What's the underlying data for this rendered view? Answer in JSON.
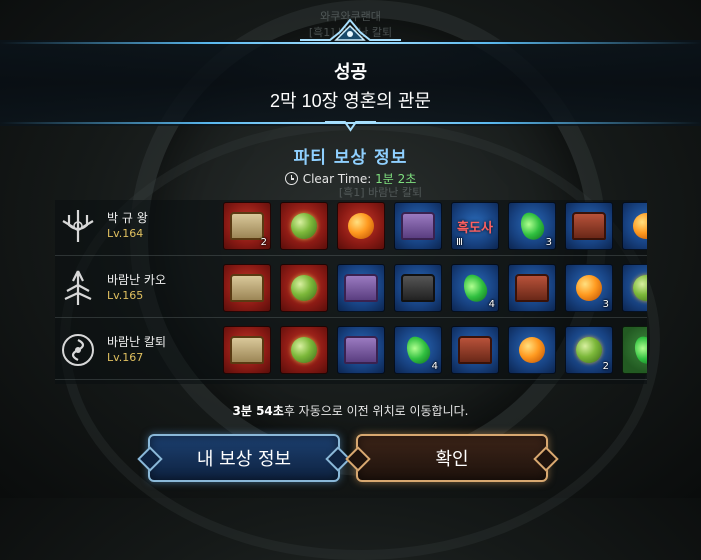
{
  "background": {
    "ghost_lines": [
      "와쿠와쿠랜대",
      "[흑1] 바람난 칼퇴",
      "[흑1] 바람난 칼퇴"
    ]
  },
  "header": {
    "result": "성공",
    "stage": "2막 10장 영혼의 관문"
  },
  "rewards": {
    "title": "파티 보상 정보",
    "clear_time_label": "Clear Time:",
    "clear_time_value": "1분 2초",
    "players": [
      {
        "name": "박 규 왕",
        "level": "Lv.164",
        "class_icon": "trident-crest-icon",
        "items": [
          {
            "bg": "red",
            "kind": "chest",
            "variant": "gold",
            "count": "2"
          },
          {
            "bg": "red",
            "kind": "orb",
            "variant": "green",
            "count": ""
          },
          {
            "bg": "red",
            "kind": "orb",
            "variant": "orange",
            "count": ""
          },
          {
            "bg": "blue",
            "kind": "chest",
            "variant": "purple",
            "count": ""
          },
          {
            "bg": "blue",
            "kind": "text",
            "variant": "흑도사",
            "count": "Ⅲ"
          },
          {
            "bg": "blue",
            "kind": "leaf",
            "variant": "green",
            "count": "3"
          },
          {
            "bg": "blue",
            "kind": "chest",
            "variant": "red",
            "count": ""
          },
          {
            "bg": "blue",
            "kind": "orb",
            "variant": "orange",
            "count": ""
          }
        ]
      },
      {
        "name": "바람난 카오",
        "level": "Lv.165",
        "class_icon": "spear-crest-icon",
        "items": [
          {
            "bg": "red",
            "kind": "chest",
            "variant": "gold",
            "count": ""
          },
          {
            "bg": "red",
            "kind": "orb",
            "variant": "green",
            "count": ""
          },
          {
            "bg": "blue",
            "kind": "chest",
            "variant": "purple",
            "count": ""
          },
          {
            "bg": "blue",
            "kind": "chest",
            "variant": "dark",
            "count": ""
          },
          {
            "bg": "blue",
            "kind": "leaf",
            "variant": "green",
            "count": "4"
          },
          {
            "bg": "blue",
            "kind": "chest",
            "variant": "red",
            "count": ""
          },
          {
            "bg": "blue",
            "kind": "orb",
            "variant": "orange",
            "count": "3"
          },
          {
            "bg": "blue",
            "kind": "orb",
            "variant": "green",
            "count": ""
          }
        ]
      },
      {
        "name": "바람난 칼퇴",
        "level": "Lv.167",
        "class_icon": "swirl-crest-icon",
        "items": [
          {
            "bg": "red",
            "kind": "chest",
            "variant": "gold",
            "count": ""
          },
          {
            "bg": "red",
            "kind": "orb",
            "variant": "green",
            "count": ""
          },
          {
            "bg": "blue",
            "kind": "chest",
            "variant": "purple",
            "count": ""
          },
          {
            "bg": "blue",
            "kind": "leaf",
            "variant": "green",
            "count": "4"
          },
          {
            "bg": "blue",
            "kind": "chest",
            "variant": "red",
            "count": ""
          },
          {
            "bg": "blue",
            "kind": "orb",
            "variant": "orange",
            "count": ""
          },
          {
            "bg": "blue",
            "kind": "orb",
            "variant": "green",
            "count": "2"
          },
          {
            "bg": "green",
            "kind": "leaf",
            "variant": "green",
            "count": ""
          }
        ]
      }
    ]
  },
  "footer": {
    "countdown": "3분 54초",
    "countdown_suffix": "후 자동으로 이전 위치로 이동합니다.",
    "my_rewards_button": "내 보상 정보",
    "confirm_button": "확인"
  }
}
